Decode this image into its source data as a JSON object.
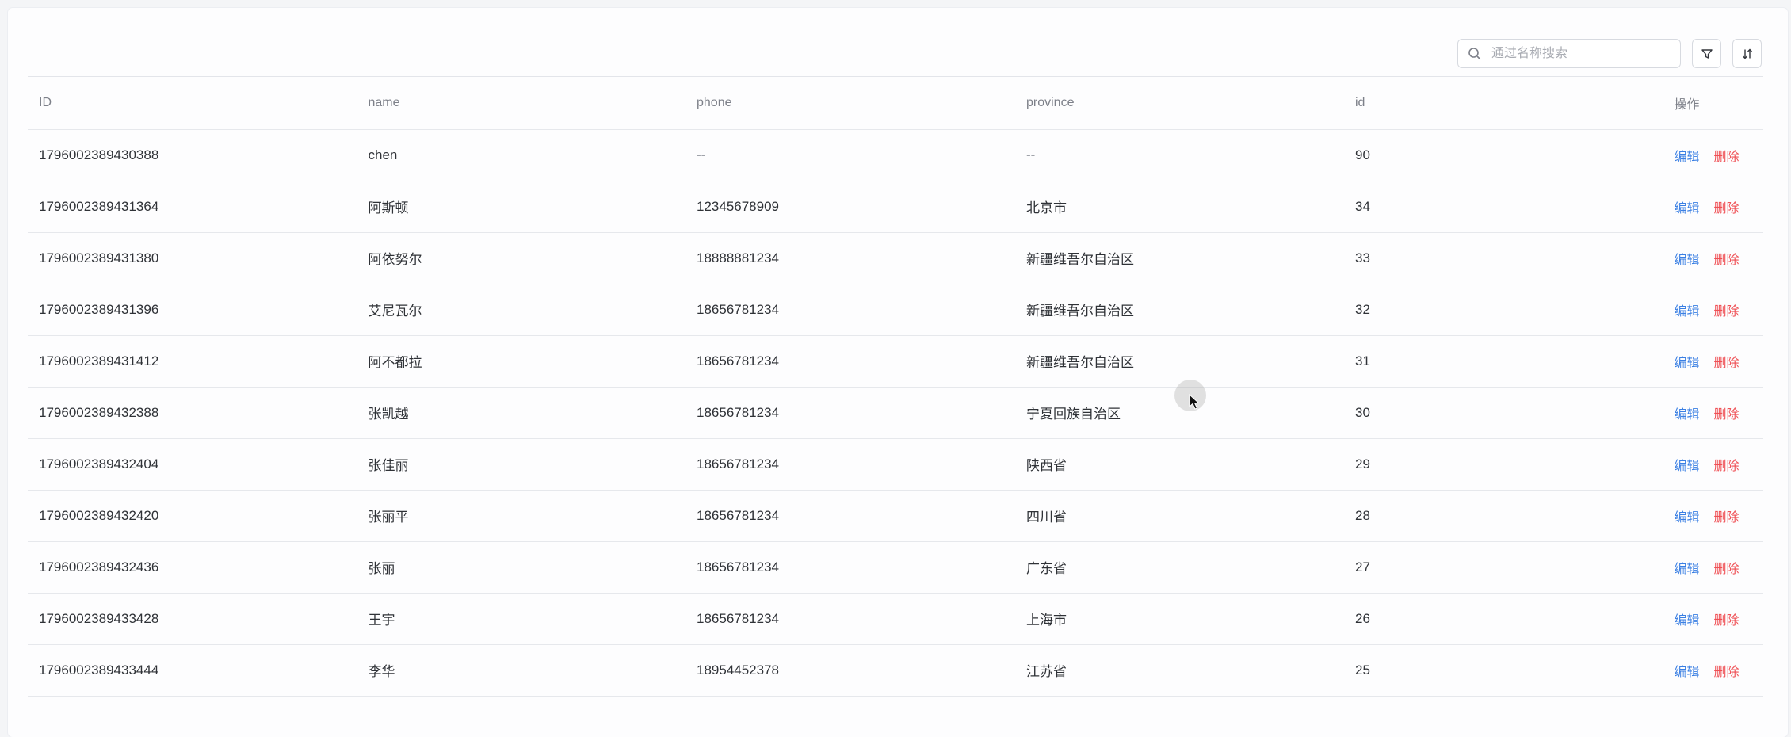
{
  "search": {
    "placeholder": "通过名称搜索"
  },
  "toolbar": {
    "filter_icon": "filter-icon",
    "sort_icon": "sort-icon"
  },
  "table": {
    "columns": [
      "ID",
      "name",
      "phone",
      "province",
      "id",
      "操作"
    ],
    "rows": [
      {
        "ID": "1796002389430388",
        "name": "chen",
        "phone": "--",
        "province": "--",
        "id": "90"
      },
      {
        "ID": "1796002389431364",
        "name": "阿斯顿",
        "phone": "12345678909",
        "province": "北京市",
        "id": "34"
      },
      {
        "ID": "1796002389431380",
        "name": "阿依努尔",
        "phone": "18888881234",
        "province": "新疆维吾尔自治区",
        "id": "33"
      },
      {
        "ID": "1796002389431396",
        "name": "艾尼瓦尔",
        "phone": "18656781234",
        "province": "新疆维吾尔自治区",
        "id": "32"
      },
      {
        "ID": "1796002389431412",
        "name": "阿不都拉",
        "phone": "18656781234",
        "province": "新疆维吾尔自治区",
        "id": "31"
      },
      {
        "ID": "1796002389432388",
        "name": "张凯越",
        "phone": "18656781234",
        "province": "宁夏回族自治区",
        "id": "30"
      },
      {
        "ID": "1796002389432404",
        "name": "张佳丽",
        "phone": "18656781234",
        "province": "陕西省",
        "id": "29"
      },
      {
        "ID": "1796002389432420",
        "name": "张丽平",
        "phone": "18656781234",
        "province": "四川省",
        "id": "28"
      },
      {
        "ID": "1796002389432436",
        "name": "张丽",
        "phone": "18656781234",
        "province": "广东省",
        "id": "27"
      },
      {
        "ID": "1796002389433428",
        "name": "王宇",
        "phone": "18656781234",
        "province": "上海市",
        "id": "26"
      },
      {
        "ID": "1796002389433444",
        "name": "李华",
        "phone": "18954452378",
        "province": "江苏省",
        "id": "25"
      }
    ],
    "actions": {
      "edit": "编辑",
      "delete": "删除"
    }
  },
  "colors": {
    "edit_link": "#3a7fe3",
    "delete_link": "#ef4f54",
    "header_text": "#7d8089"
  }
}
